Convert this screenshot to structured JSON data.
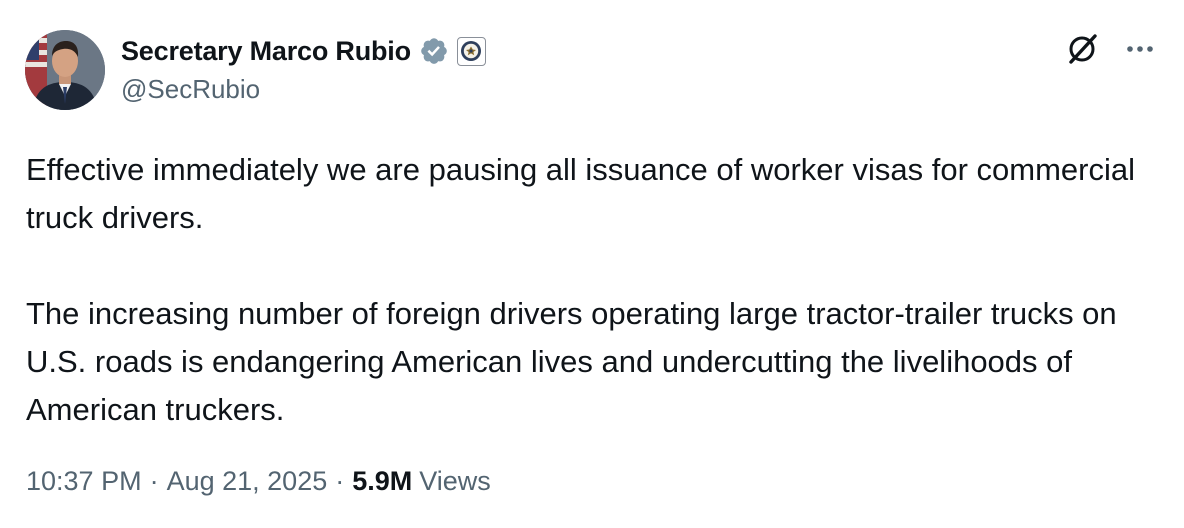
{
  "author": {
    "display_name": "Secretary Marco Rubio",
    "handle": "@SecRubio",
    "avatar_icon": "profile-photo",
    "verified_icon": "verified-badge-icon",
    "verified_color": "#829aab",
    "affiliate_icon": "state-department-seal-icon"
  },
  "header_actions": {
    "grok_icon": "grok-icon",
    "more_icon": "more-options-icon"
  },
  "tweet": {
    "paragraphs": [
      "Effective immediately we are pausing all issuance of worker visas for commercial truck drivers.",
      "The increasing number of foreign drivers operating large tractor-trailer trucks on U.S. roads is endangering American lives and undercutting the livelihoods of American truckers."
    ]
  },
  "meta": {
    "time": "10:37 PM",
    "separator": "·",
    "date": "Aug 21, 2025",
    "views_count": "5.9M",
    "views_label": "Views"
  },
  "colors": {
    "text_primary": "#0f1419",
    "text_secondary": "#536471",
    "background": "#ffffff"
  }
}
